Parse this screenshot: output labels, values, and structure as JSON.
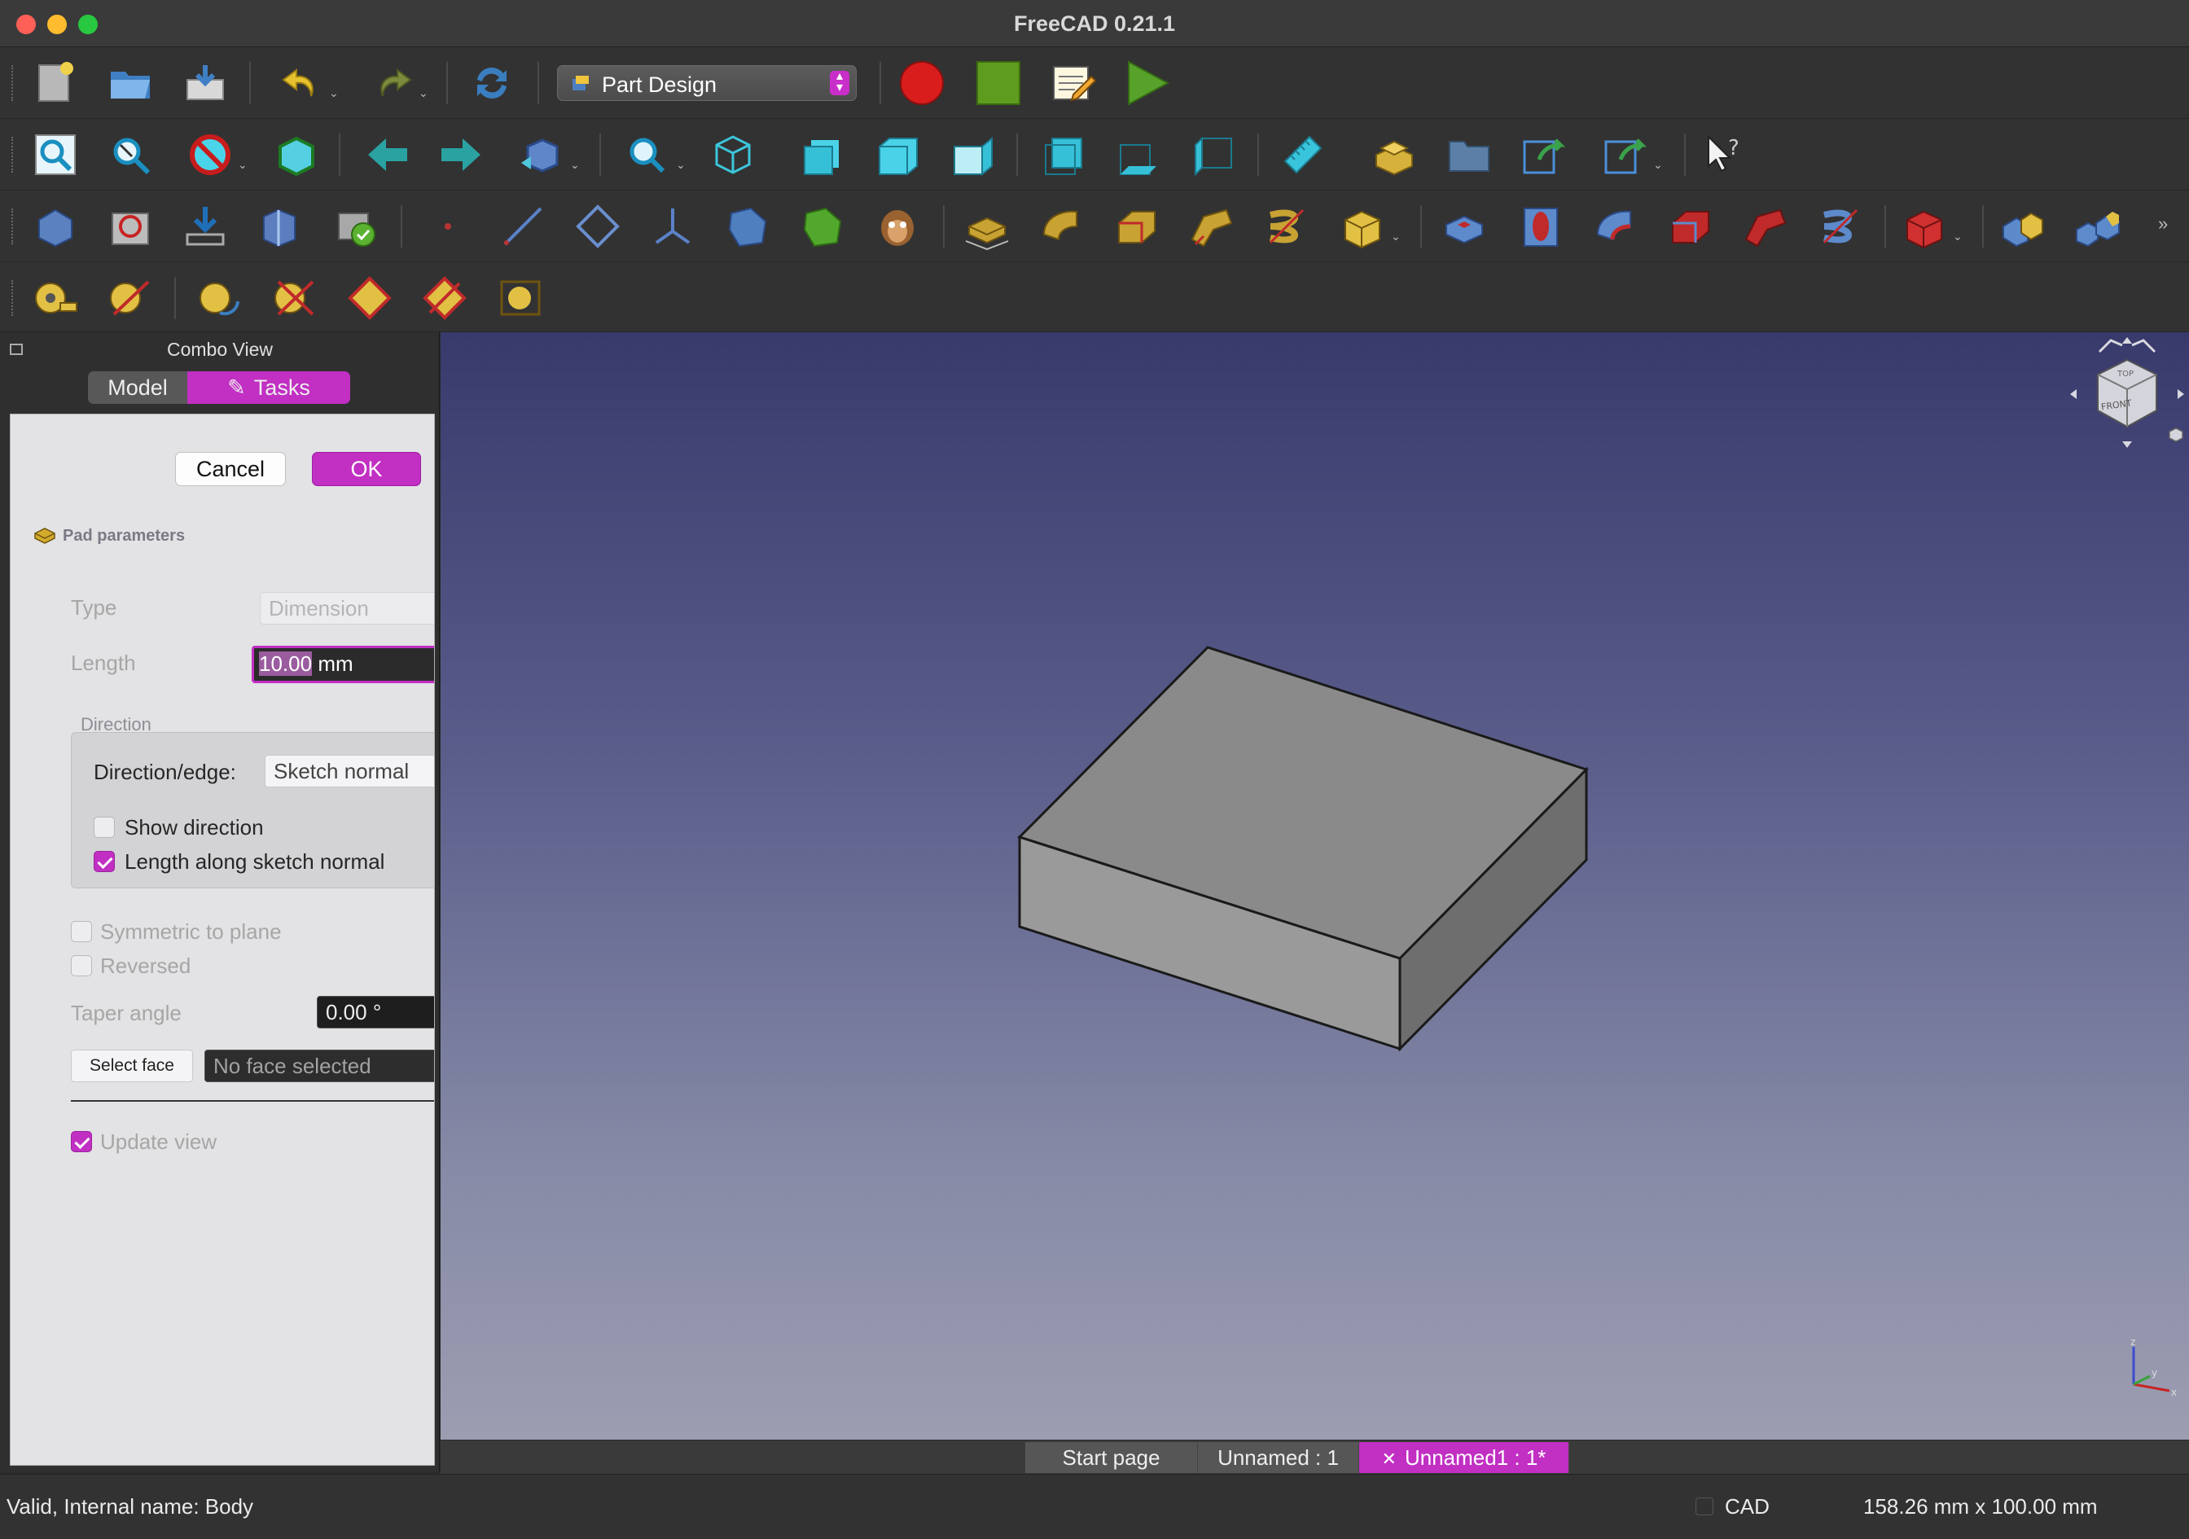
{
  "window": {
    "title": "FreeCAD 0.21.1"
  },
  "toolbar": {
    "workbench": "Part Design",
    "row1_icons": [
      "new-file-icon",
      "open-file-icon",
      "save-icon",
      "undo-icon",
      "redo-icon",
      "refresh-icon",
      "macro-record-icon",
      "macro-stop-icon",
      "macro-edit-icon",
      "macro-run-icon"
    ],
    "row2_icons": [
      "fit-all-icon",
      "fit-selection-icon",
      "draw-style-icon",
      "bounding-box-icon",
      "back-icon",
      "forward-icon",
      "workbench-view-icon",
      "zoom-icon",
      "isometric-view-icon",
      "front-view-icon",
      "top-view-icon",
      "right-view-icon",
      "rear-view-icon",
      "bottom-view-icon",
      "left-view-icon",
      "measure-icon",
      "part-icon",
      "group-icon",
      "link-icon",
      "link-actions-icon",
      "whats-this-icon"
    ],
    "row3_icons": [
      "create-body-icon",
      "create-sketch-icon",
      "validate-sketch-icon",
      "shape-binder-icon",
      "clone-icon",
      "datum-point-icon",
      "datum-line-icon",
      "datum-plane-icon",
      "local-cs-icon",
      "subshape-binder-icon",
      "sub-object-shape-binder-icon",
      "pad-icon",
      "revolution-icon",
      "additive-loft-icon",
      "additive-pipe-icon",
      "additive-helix-icon",
      "additive-primitive-icon",
      "pocket-icon",
      "hole-icon",
      "groove-icon",
      "subtractive-loft-icon",
      "subtractive-pipe-icon",
      "subtractive-helix-icon",
      "subtractive-primitive-icon",
      "mirrored-icon",
      "linear-pattern-icon"
    ],
    "row4_icons": [
      "measure-linear-icon",
      "measure-angular-icon",
      "measure-refresh-icon",
      "measure-clear-icon",
      "measure-toggle-all-icon",
      "measure-toggle-3d-icon",
      "measure-toggle-delta-icon"
    ]
  },
  "combo_view": {
    "title": "Combo View",
    "tabs": {
      "model": "Model",
      "tasks": "Tasks"
    },
    "buttons": {
      "cancel": "Cancel",
      "ok": "OK"
    },
    "pad_parameters": {
      "header": "Pad parameters",
      "type_label": "Type",
      "type_value": "Dimension",
      "length_label": "Length",
      "length_number": "10.00",
      "length_unit": "mm",
      "direction_group": "Direction",
      "direction_edge_label": "Direction/edge:",
      "direction_edge_value": "Sketch normal",
      "show_direction": "Show direction",
      "length_along_normal": "Length along sketch normal",
      "symmetric": "Symmetric to plane",
      "reversed": "Reversed",
      "taper_label": "Taper angle",
      "taper_value": "0.00 °",
      "select_face_button": "Select face",
      "face_placeholder": "No face selected",
      "update_view": "Update view"
    },
    "checkboxes": {
      "show_direction": false,
      "length_along_normal": true,
      "symmetric": false,
      "reversed": false,
      "update_view": true
    }
  },
  "viewport": {
    "navcube_labels": {
      "top": "TOP",
      "front": "FRONT"
    },
    "axis_labels": {
      "x": "x",
      "y": "y",
      "z": "z"
    }
  },
  "document_tabs": [
    {
      "label": "Start page"
    },
    {
      "label": "Unnamed : 1"
    },
    {
      "label": "Unnamed1 : 1*",
      "close_glyph": "✕"
    }
  ],
  "status_bar": {
    "message": "Valid, Internal name: Body",
    "nav_style": "CAD",
    "dimensions": "158.26 mm x 100.00 mm"
  },
  "colors": {
    "accent": "#c12fc3",
    "viewport_top": "#383a6c",
    "viewport_bottom": "#9c9db1",
    "solid_face": "#8a8a8a"
  }
}
